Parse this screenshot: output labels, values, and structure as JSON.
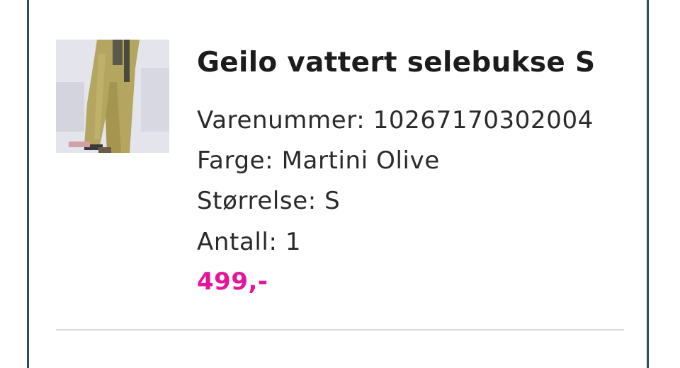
{
  "product": {
    "title": "Geilo vattert selebukse S",
    "sku_line": "Varenummer: 10267170302004",
    "color_line": "Farge: Martini Olive",
    "size_line": "Størrelse: S",
    "quantity_line": "Antall: 1",
    "price": "499,-",
    "price_color": "#e6149a",
    "image_icon": "product-thumbnail"
  },
  "colors": {
    "frame": "#2b4a63",
    "divider": "#d8d8d8"
  }
}
